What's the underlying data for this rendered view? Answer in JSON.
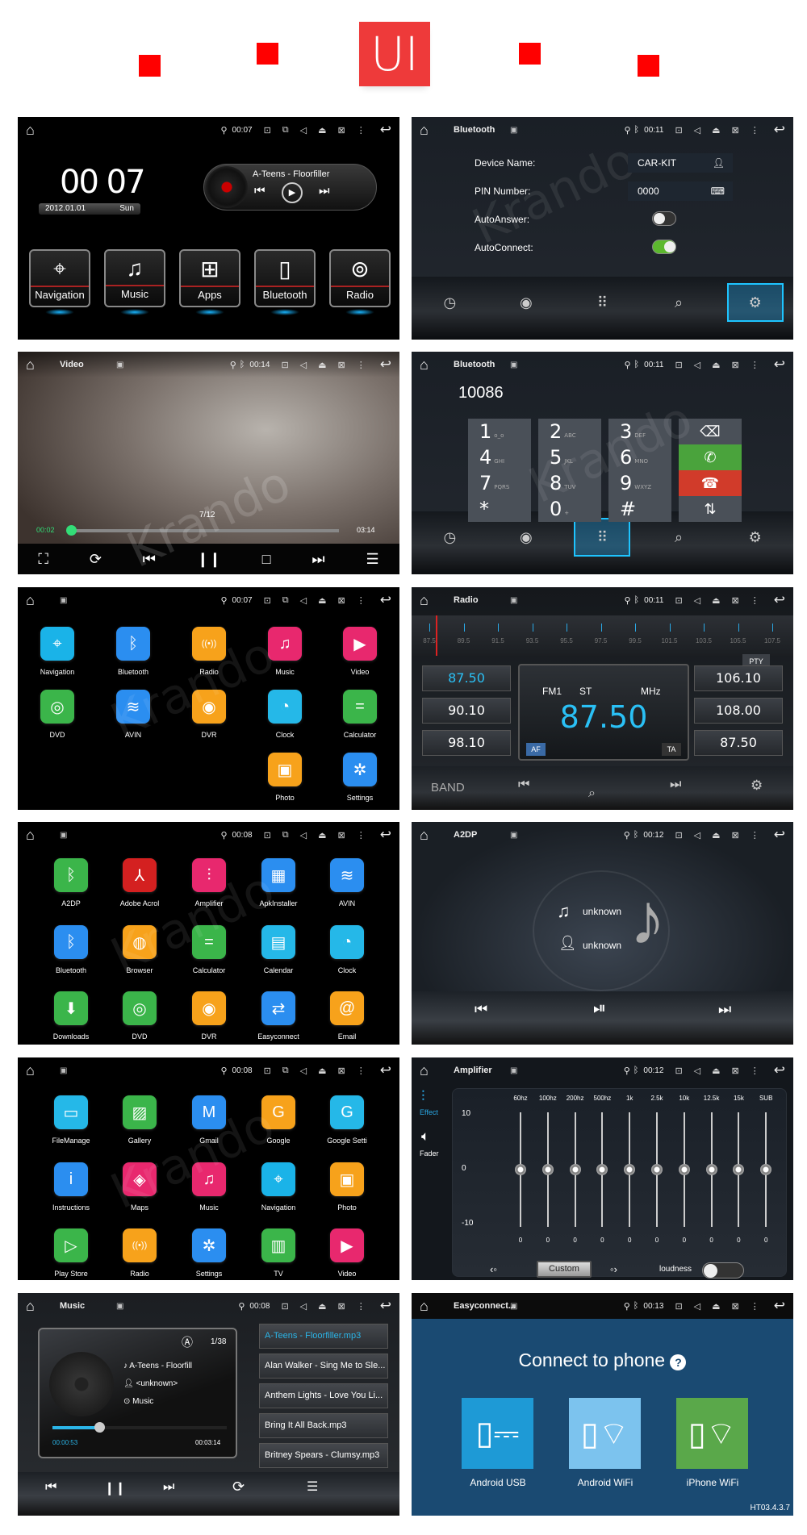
{
  "header": {
    "label": "UI",
    "accent": "#ee3a3a"
  },
  "watermark": "Krando",
  "home": {
    "status": {
      "title": "",
      "time": "00:07",
      "bt": false,
      "img": false,
      "win": true
    },
    "clock": "00 07",
    "date": "2012.01.01",
    "day": "Sun",
    "track": "A-Teens - Floorfiller",
    "tiles": [
      {
        "label": "Navigation",
        "icon": "⌖"
      },
      {
        "label": "Music",
        "icon": "♫"
      },
      {
        "label": "Apps",
        "icon": "⊞"
      },
      {
        "label": "Bluetooth",
        "icon": "▯"
      },
      {
        "label": "Radio",
        "icon": "⊚"
      }
    ]
  },
  "bt_settings": {
    "status": {
      "title": "Bluetooth",
      "time": "00:11",
      "bt": true,
      "img": true
    },
    "device_label": "Device Name:",
    "device_value": "CAR-KIT",
    "pin_label": "PIN Number:",
    "pin_value": "0000",
    "autoanswer_label": "AutoAnswer:",
    "autoanswer_on": false,
    "autoconnect_label": "AutoConnect:",
    "autoconnect_on": true,
    "dock_active": "settings"
  },
  "video": {
    "status": {
      "title": "Video",
      "time": "00:14",
      "bt": true,
      "img": true
    },
    "counter": "7/12",
    "elapsed": "00:02",
    "total": "03:14",
    "progress": 0.01
  },
  "dialer": {
    "status": {
      "title": "Bluetooth",
      "time": "00:11",
      "bt": true,
      "img": true
    },
    "number": "10086",
    "keys": [
      [
        "1",
        "o_o"
      ],
      [
        "2",
        "ABC"
      ],
      [
        "3",
        "DEF"
      ],
      [
        "4",
        "GHI"
      ],
      [
        "5",
        "JKL"
      ],
      [
        "6",
        "MNO"
      ],
      [
        "7",
        "PQRS"
      ],
      [
        "8",
        "TUV"
      ],
      [
        "9",
        "WXYZ"
      ],
      [
        "*",
        ""
      ],
      [
        "0",
        "+"
      ],
      [
        "#",
        ""
      ]
    ],
    "dock_active": "dialpad"
  },
  "apps1": {
    "status": {
      "title": "",
      "time": "00:07",
      "bt": false,
      "img": true,
      "win": true
    },
    "apps": [
      {
        "label": "Navigation",
        "color": "#1ab3e8",
        "icon": "⌖",
        "r": 0,
        "c": 0
      },
      {
        "label": "Bluetooth",
        "color": "#2b8ef0",
        "icon": "ᛒ",
        "r": 0,
        "c": 1
      },
      {
        "label": "Radio",
        "color": "#f7a21b",
        "icon": "((•))",
        "r": 0,
        "c": 2
      },
      {
        "label": "Music",
        "color": "#e8286e",
        "icon": "♫",
        "r": 0,
        "c": 3
      },
      {
        "label": "Video",
        "color": "#e8286e",
        "icon": "▶",
        "r": 0,
        "c": 4
      },
      {
        "label": "DVD",
        "color": "#3bb54a",
        "icon": "◎",
        "r": 1,
        "c": 0
      },
      {
        "label": "AVIN",
        "color": "#2b8ef0",
        "icon": "≋",
        "r": 1,
        "c": 1
      },
      {
        "label": "DVR",
        "color": "#f7a21b",
        "icon": "◉",
        "r": 1,
        "c": 2
      },
      {
        "label": "Clock",
        "color": "#25b8e8",
        "icon": "◔",
        "r": 1,
        "c": 3
      },
      {
        "label": "Calculator",
        "color": "#3bb54a",
        "icon": "=",
        "r": 1,
        "c": 4
      },
      {
        "label": "Photo",
        "color": "#f7a21b",
        "icon": "▣",
        "r": 2,
        "c": 3
      },
      {
        "label": "Settings",
        "color": "#2b8ef0",
        "icon": "✲",
        "r": 2,
        "c": 4
      }
    ]
  },
  "radio": {
    "status": {
      "title": "Radio",
      "time": "00:11",
      "bt": true,
      "img": true
    },
    "scale": [
      "87.5",
      "89.5",
      "91.5",
      "93.5",
      "95.5",
      "97.5",
      "99.5",
      "101.5",
      "103.5",
      "105.5",
      "107.5"
    ],
    "presets_left": [
      "87.50",
      "90.10",
      "98.10"
    ],
    "presets_right": [
      "106.10",
      "108.00",
      "87.50"
    ],
    "band": "FM1",
    "stereo": "ST",
    "unit": "MHz",
    "frequency": "87.50",
    "af": "AF",
    "ta": "TA",
    "pty": "PTY",
    "band_button": "BAND"
  },
  "apps2": {
    "status": {
      "title": "",
      "time": "00:08",
      "bt": false,
      "img": true,
      "win": true
    },
    "apps": [
      {
        "label": "A2DP",
        "color": "#3bb54a",
        "icon": "ᛒ",
        "r": 0,
        "c": 0
      },
      {
        "label": "Adobe Acrol",
        "color": "#d42020",
        "icon": "⅄",
        "r": 0,
        "c": 1
      },
      {
        "label": "Amplifier",
        "color": "#e8286e",
        "icon": "⫶",
        "r": 0,
        "c": 2
      },
      {
        "label": "ApkInstaller",
        "color": "#2b8ef0",
        "icon": "▦",
        "r": 0,
        "c": 3
      },
      {
        "label": "AVIN",
        "color": "#2b8ef0",
        "icon": "≋",
        "r": 0,
        "c": 4
      },
      {
        "label": "Bluetooth",
        "color": "#2b8ef0",
        "icon": "ᛒ",
        "r": 1,
        "c": 0
      },
      {
        "label": "Browser",
        "color": "#f7a21b",
        "icon": "◍",
        "r": 1,
        "c": 1
      },
      {
        "label": "Calculator",
        "color": "#3bb54a",
        "icon": "=",
        "r": 1,
        "c": 2
      },
      {
        "label": "Calendar",
        "color": "#25b8e8",
        "icon": "▤",
        "r": 1,
        "c": 3
      },
      {
        "label": "Clock",
        "color": "#25b8e8",
        "icon": "◔",
        "r": 1,
        "c": 4
      },
      {
        "label": "Downloads",
        "color": "#3bb54a",
        "icon": "⬇",
        "r": 2,
        "c": 0
      },
      {
        "label": "DVD",
        "color": "#3bb54a",
        "icon": "◎",
        "r": 2,
        "c": 1
      },
      {
        "label": "DVR",
        "color": "#f7a21b",
        "icon": "◉",
        "r": 2,
        "c": 2
      },
      {
        "label": "Easyconnect",
        "color": "#2b8ef0",
        "icon": "⇄",
        "r": 2,
        "c": 3
      },
      {
        "label": "Email",
        "color": "#f7a21b",
        "icon": "@",
        "r": 2,
        "c": 4
      }
    ]
  },
  "a2dp": {
    "status": {
      "title": "A2DP",
      "time": "00:12",
      "bt": true,
      "img": true
    },
    "song": "unknown",
    "artist": "unknown"
  },
  "apps3": {
    "status": {
      "title": "",
      "time": "00:08",
      "bt": false,
      "img": true,
      "win": true
    },
    "apps": [
      {
        "label": "FileManage",
        "color": "#25b8e8",
        "icon": "▭",
        "r": 0,
        "c": 0
      },
      {
        "label": "Gallery",
        "color": "#3bb54a",
        "icon": "▨",
        "r": 0,
        "c": 1
      },
      {
        "label": "Gmail",
        "color": "#2b8ef0",
        "icon": "M",
        "r": 0,
        "c": 2
      },
      {
        "label": "Google",
        "color": "#f7a21b",
        "icon": "G",
        "r": 0,
        "c": 3
      },
      {
        "label": "Google Setti",
        "color": "#25b8e8",
        "icon": "G",
        "r": 0,
        "c": 4
      },
      {
        "label": "Instructions",
        "color": "#2b8ef0",
        "icon": "i",
        "r": 1,
        "c": 0
      },
      {
        "label": "Maps",
        "color": "#e8286e",
        "icon": "◈",
        "r": 1,
        "c": 1
      },
      {
        "label": "Music",
        "color": "#e8286e",
        "icon": "♫",
        "r": 1,
        "c": 2
      },
      {
        "label": "Navigation",
        "color": "#1ab3e8",
        "icon": "⌖",
        "r": 1,
        "c": 3
      },
      {
        "label": "Photo",
        "color": "#f7a21b",
        "icon": "▣",
        "r": 1,
        "c": 4
      },
      {
        "label": "Play Store",
        "color": "#3bb54a",
        "icon": "▷",
        "r": 2,
        "c": 0
      },
      {
        "label": "Radio",
        "color": "#f7a21b",
        "icon": "((•))",
        "r": 2,
        "c": 1
      },
      {
        "label": "Settings",
        "color": "#2b8ef0",
        "icon": "✲",
        "r": 2,
        "c": 2
      },
      {
        "label": "TV",
        "color": "#3bb54a",
        "icon": "▥",
        "r": 2,
        "c": 3
      },
      {
        "label": "Video",
        "color": "#e8286e",
        "icon": "▶",
        "r": 2,
        "c": 4
      }
    ]
  },
  "amplifier": {
    "status": {
      "title": "Amplifier",
      "time": "00:12",
      "bt": true,
      "img": true
    },
    "effect_label": "Effect",
    "fader_label": "Fader",
    "scale": [
      "10",
      "0",
      "-10"
    ],
    "bands": [
      {
        "label": "60hz",
        "value": 0
      },
      {
        "label": "100hz",
        "value": 0
      },
      {
        "label": "200hz",
        "value": 0
      },
      {
        "label": "500hz",
        "value": 0
      },
      {
        "label": "1k",
        "value": 0
      },
      {
        "label": "2.5k",
        "value": 0
      },
      {
        "label": "10k",
        "value": 0
      },
      {
        "label": "12.5k",
        "value": 0
      },
      {
        "label": "15k",
        "value": 0
      },
      {
        "label": "SUB",
        "value": 0
      }
    ],
    "preset": "Custom",
    "loudness_label": "loudness",
    "loudness_on": false
  },
  "music": {
    "status": {
      "title": "Music",
      "time": "00:08",
      "bt": false,
      "img": true
    },
    "index": "1/38",
    "title": "A-Teens - Floorfill",
    "artist": "<unknown>",
    "album": "Music",
    "elapsed": "00:00:53",
    "total": "00:03:14",
    "progress": 0.27,
    "playlist": [
      "A-Teens - Floorfiller.mp3",
      "Alan Walker - Sing Me to Sle...",
      "Anthem Lights - Love You Li...",
      "Bring It All Back.mp3",
      "Britney Spears - Clumsy.mp3"
    ],
    "active_color": "#2bb5e8"
  },
  "easyconnect": {
    "status": {
      "title": "Easyconnect...",
      "time": "00:13",
      "bt": true,
      "img": true
    },
    "heading": "Connect to phone",
    "help": "?",
    "options": [
      {
        "label": "Android USB",
        "color": "#1e9ad6"
      },
      {
        "label": "Android WiFi",
        "color": "#7cc3ee"
      },
      {
        "label": "iPhone WiFi",
        "color": "#5aa84a"
      }
    ],
    "version": "HT03.4.3.7"
  }
}
